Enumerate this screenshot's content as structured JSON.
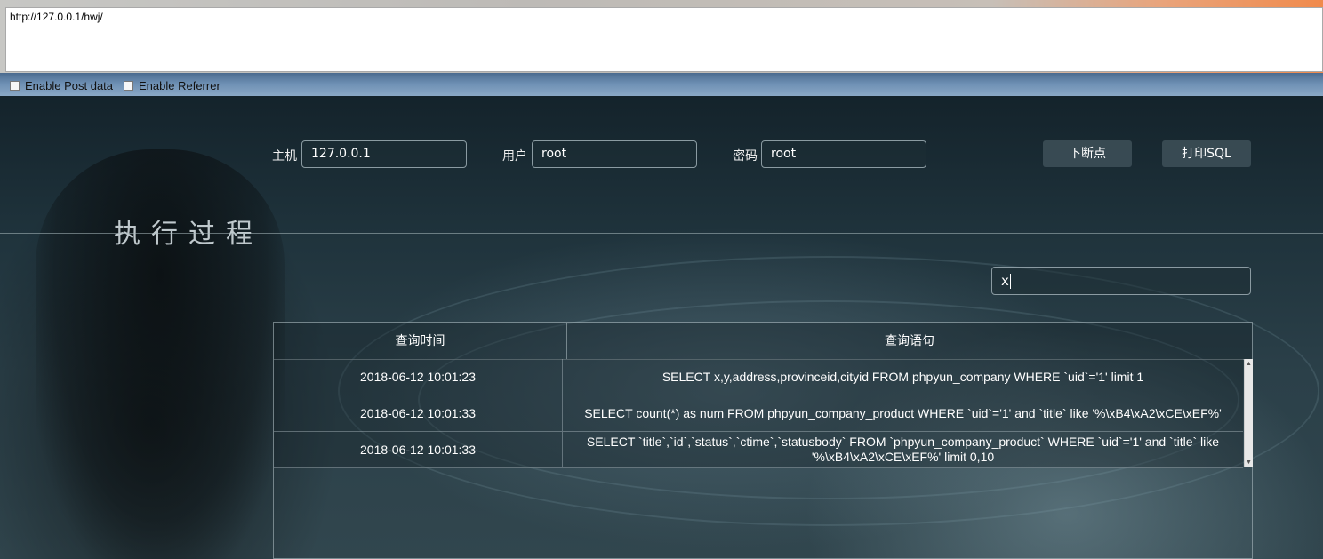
{
  "toolbar": {
    "url": "http://127.0.0.1/hwj/",
    "enable_post_label": "Enable Post data",
    "enable_referrer_label": "Enable Referrer"
  },
  "form": {
    "host_label": "主机",
    "host_value": "127.0.0.1",
    "user_label": "用户",
    "user_value": "root",
    "password_label": "密码",
    "password_value": "root",
    "breakpoint_button": "下断点",
    "print_sql_button": "打印SQL"
  },
  "section": {
    "title": "执行过程"
  },
  "search": {
    "value": "x"
  },
  "table": {
    "headers": [
      "查询时间",
      "查询语句"
    ],
    "rows": [
      {
        "time": "2018-06-12 10:01:23",
        "sql": "SELECT x,y,address,provinceid,cityid FROM phpyun_company WHERE `uid`='1' limit 1"
      },
      {
        "time": "2018-06-12 10:01:33",
        "sql": "SELECT count(*) as num FROM phpyun_company_product WHERE `uid`='1' and `title` like '%\\xB4\\xA2\\xCE\\xEF%'"
      },
      {
        "time": "2018-06-12 10:01:33",
        "sql": "SELECT `title`,`id`,`status`,`ctime`,`statusbody` FROM `phpyun_company_product` WHERE `uid`='1' and `title` like '%\\xB4\\xA2\\xCE\\xEF%' limit 0,10"
      }
    ]
  },
  "colors": {
    "scene_bg": "#1c2d35",
    "button_bg": "#3c4e56",
    "text": "#ffffff"
  }
}
